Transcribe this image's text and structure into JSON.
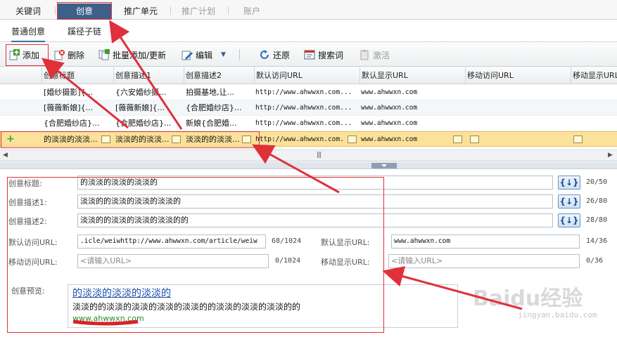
{
  "top_tabs": [
    {
      "label": "关键词"
    },
    {
      "label": "创意"
    },
    {
      "label": "推广单元"
    },
    {
      "label": "推广计划"
    },
    {
      "label": "账户"
    }
  ],
  "sub_tabs": [
    {
      "label": "普通创意"
    },
    {
      "label": "蹊径子链"
    }
  ],
  "toolbar": {
    "add": "添加",
    "delete": "删除",
    "batch": "批量添加/更新",
    "edit": "编辑",
    "restore": "还原",
    "search_word": "搜索词",
    "activate": "激活"
  },
  "grid": {
    "columns": [
      "创意标题",
      "创意描述1",
      "创意描述2",
      "默认访问URL",
      "默认显示URL",
      "移动访问URL",
      "移动显示URL"
    ],
    "rows": [
      {
        "title": "[婚纱摄影]{...",
        "desc1": "{六安婚纱摄...",
        "desc2": "拍摄基地,让...",
        "url": "http://www.ahwwxn.com...",
        "display_url": "www.ahwwxn.com",
        "mobile_url": "",
        "mobile_display": ""
      },
      {
        "title": "[薇薇新娘]{...",
        "desc1": "[薇薇新娘]{...",
        "desc2": "{合肥婚纱店}...",
        "url": "http://www.ahwwxn.com...",
        "display_url": "www.ahwwxn.com",
        "mobile_url": "",
        "mobile_display": ""
      },
      {
        "title": "{合肥婚纱店}...",
        "desc1": "{合肥婚纱店}...",
        "desc2": "新娘{合肥婚...",
        "url": "http://www.ahwwxn.com...",
        "display_url": "www.ahwwxn.com",
        "mobile_url": "",
        "mobile_display": ""
      },
      {
        "title": "的淡淡的淡淡...",
        "desc1": "淡淡的的淡淡...",
        "desc2": "淡淡的的淡淡...",
        "url": "http://www.ahwwxn.com...",
        "display_url": "www.ahwwxn.com",
        "mobile_url": "",
        "mobile_display": ""
      }
    ]
  },
  "form": {
    "title_label": "创意标题:",
    "title_value": "的淡淡的淡淡的淡淡的",
    "title_count": "20/50",
    "desc1_label": "创意描述1:",
    "desc1_value": "淡淡的的淡淡的淡淡的淡淡的",
    "desc1_count": "26/80",
    "desc2_label": "创意描述2:",
    "desc2_value": "淡淡的的淡淡的淡淡的淡淡的的",
    "desc2_count": "28/80",
    "wildcard_btn": "{↓}",
    "url_label": "默认访问URL:",
    "url_value": ".icle/weiwhttp://www.ahwwxn.com/article/weiw",
    "url_count": "68/1024",
    "display_url_label": "默认显示URL:",
    "display_url_value": "www.ahwwxn.com",
    "display_url_count": "14/36",
    "mobile_url_label": "移动访问URL:",
    "mobile_url_placeholder": "<请输入URL>",
    "mobile_url_count": "0/1024",
    "mobile_display_label": "移动显示URL:",
    "mobile_display_placeholder": "<请输入URL>",
    "mobile_display_count": "0/36",
    "preview_label": "创意预览:",
    "preview_title": "的淡淡的淡淡的淡淡的",
    "preview_desc": "淡淡的的淡淡的淡淡的淡淡的淡淡的的淡淡的淡淡的淡淡的的",
    "preview_url": "www.ahwwxn.com"
  },
  "watermark": {
    "brand": "Baidu经验",
    "site": "jingyan.baidu.com"
  },
  "colors": {
    "active_tab": "#3c6088",
    "selected_row": "#fbe19a",
    "annotation": "#e0303a"
  }
}
